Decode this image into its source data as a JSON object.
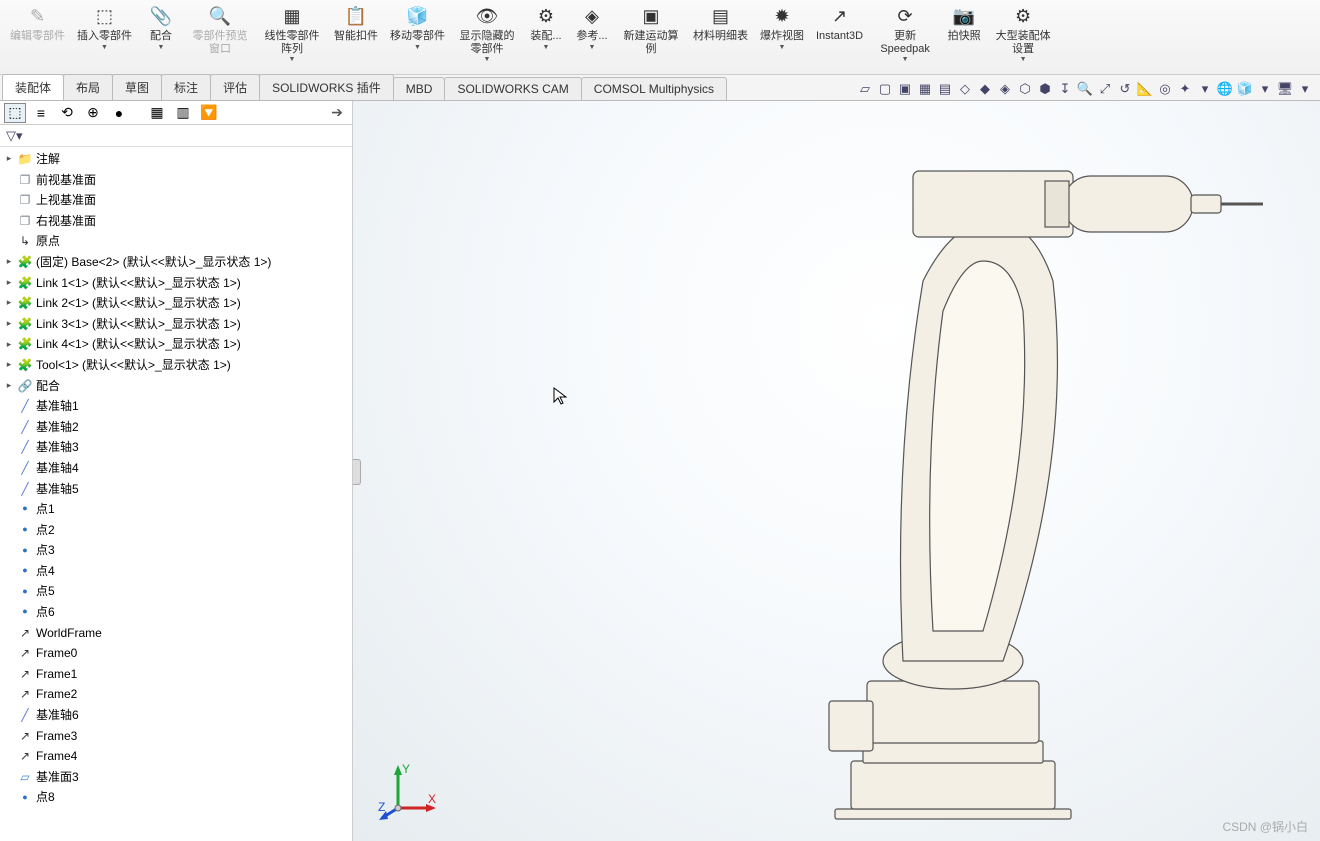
{
  "ribbon": [
    {
      "id": "edit-comp",
      "label": "编辑零部件",
      "icon": "✎",
      "disabled": true
    },
    {
      "id": "insert-comp",
      "label": "插入零部件",
      "icon": "⬚",
      "dd": true
    },
    {
      "id": "mate",
      "label": "配合",
      "icon": "📎",
      "dd": true
    },
    {
      "id": "comp-preview",
      "label": "零部件预览窗口",
      "icon": "🔍",
      "disabled": true
    },
    {
      "id": "linear-pattern",
      "label": "线性零部件阵列",
      "icon": "▦",
      "dd": true
    },
    {
      "id": "smart-fastener",
      "label": "智能扣件",
      "icon": "📋",
      "dd": false
    },
    {
      "id": "move-comp",
      "label": "移动零部件",
      "icon": "🧊",
      "dd": true
    },
    {
      "id": "show-hidden",
      "label": "显示隐藏的零部件",
      "icon": "👁",
      "dd": true
    },
    {
      "id": "assy-feat",
      "label": "装配...",
      "icon": "⚙",
      "dd": true
    },
    {
      "id": "ref-geom",
      "label": "参考...",
      "icon": "◈",
      "dd": true
    },
    {
      "id": "new-motion",
      "label": "新建运动算例",
      "icon": "▣"
    },
    {
      "id": "bom",
      "label": "材料明细表",
      "icon": "▤"
    },
    {
      "id": "exploded",
      "label": "爆炸视图",
      "icon": "✹",
      "dd": true
    },
    {
      "id": "instant3d",
      "label": "Instant3D",
      "icon": "↗"
    },
    {
      "id": "speedpak",
      "label": "更新Speedpak",
      "icon": "⟳",
      "dd": true
    },
    {
      "id": "snapshot",
      "label": "拍快照",
      "icon": "📷"
    },
    {
      "id": "large-assy",
      "label": "大型装配体设置",
      "icon": "⚙",
      "dd": true
    }
  ],
  "tabs": [
    {
      "id": "assembly",
      "label": "装配体",
      "active": true
    },
    {
      "id": "layout",
      "label": "布局"
    },
    {
      "id": "sketch",
      "label": "草图"
    },
    {
      "id": "annotate",
      "label": "标注"
    },
    {
      "id": "evaluate",
      "label": "评估"
    },
    {
      "id": "sw-addins",
      "label": "SOLIDWORKS 插件"
    },
    {
      "id": "mbd",
      "label": "MBD"
    },
    {
      "id": "sw-cam",
      "label": "SOLIDWORKS CAM"
    },
    {
      "id": "comsol",
      "label": "COMSOL Multiphysics"
    }
  ],
  "viewbar": [
    "▱",
    "▢",
    "▣",
    "▦",
    "▤",
    "◇",
    "◆",
    "◈",
    "⬡",
    "⬢",
    "↧",
    "🔍",
    "⤢",
    "↺",
    "📐",
    "◎",
    "✦",
    "▾",
    "🌐",
    "🧊",
    "▾",
    "🖥",
    "▾"
  ],
  "mgr_tabs": [
    "⬚",
    "≡",
    "⟲",
    "⊕",
    "●",
    "",
    "▦",
    "▥",
    "🔽"
  ],
  "tree": [
    {
      "d": 0,
      "exp": "▸",
      "ic": "folder",
      "t": "注解"
    },
    {
      "d": 0,
      "ic": "plane",
      "t": "前视基准面"
    },
    {
      "d": 0,
      "ic": "plane",
      "t": "上视基准面"
    },
    {
      "d": 0,
      "ic": "plane",
      "t": "右视基准面"
    },
    {
      "d": 0,
      "ic": "origin",
      "t": "原点"
    },
    {
      "d": 0,
      "exp": "▸",
      "ic": "part",
      "t": "(固定) Base<2> (默认<<默认>_显示状态 1>)"
    },
    {
      "d": 0,
      "exp": "▸",
      "ic": "part",
      "t": "Link 1<1> (默认<<默认>_显示状态 1>)"
    },
    {
      "d": 0,
      "exp": "▸",
      "ic": "part",
      "t": "Link 2<1> (默认<<默认>_显示状态 1>)"
    },
    {
      "d": 0,
      "exp": "▸",
      "ic": "part",
      "t": "Link 3<1> (默认<<默认>_显示状态 1>)"
    },
    {
      "d": 0,
      "exp": "▸",
      "ic": "part",
      "t": "Link 4<1> (默认<<默认>_显示状态 1>)"
    },
    {
      "d": 0,
      "exp": "▸",
      "ic": "part",
      "t": "Tool<1> (默认<<默认>_显示状态 1>)"
    },
    {
      "d": 0,
      "exp": "▸",
      "ic": "mate",
      "t": "配合"
    },
    {
      "d": 0,
      "ic": "axis",
      "t": "基准轴1"
    },
    {
      "d": 0,
      "ic": "axis",
      "t": "基准轴2"
    },
    {
      "d": 0,
      "ic": "axis",
      "t": "基准轴3"
    },
    {
      "d": 0,
      "ic": "axis",
      "t": "基准轴4"
    },
    {
      "d": 0,
      "ic": "axis",
      "t": "基准轴5"
    },
    {
      "d": 0,
      "ic": "point",
      "t": "点1"
    },
    {
      "d": 0,
      "ic": "point",
      "t": "点2"
    },
    {
      "d": 0,
      "ic": "point",
      "t": "点3"
    },
    {
      "d": 0,
      "ic": "point",
      "t": "点4"
    },
    {
      "d": 0,
      "ic": "point",
      "t": "点5"
    },
    {
      "d": 0,
      "ic": "point",
      "t": "点6"
    },
    {
      "d": 0,
      "ic": "coord",
      "t": "WorldFrame"
    },
    {
      "d": 0,
      "ic": "coord",
      "t": "Frame0"
    },
    {
      "d": 0,
      "ic": "coord",
      "t": "Frame1"
    },
    {
      "d": 0,
      "ic": "coord",
      "t": "Frame2"
    },
    {
      "d": 0,
      "ic": "axis",
      "t": "基准轴6"
    },
    {
      "d": 0,
      "ic": "coord",
      "t": "Frame3"
    },
    {
      "d": 0,
      "ic": "coord",
      "t": "Frame4"
    },
    {
      "d": 0,
      "ic": "face",
      "t": "基准面3"
    },
    {
      "d": 0,
      "ic": "point",
      "t": "点8"
    }
  ],
  "csys": {
    "x": "X",
    "y": "Y",
    "z": "Z"
  },
  "watermark": "CSDN @锅小白"
}
